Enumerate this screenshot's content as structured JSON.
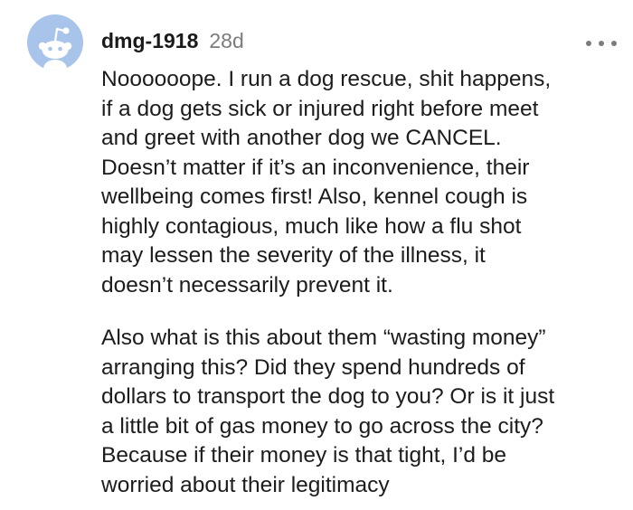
{
  "comment": {
    "username": "dmg-1918",
    "timestamp": "28d",
    "avatar_icon": "reddit-snoo-icon",
    "more_icon": "more-options-icon",
    "paragraphs": [
      {
        "lines": [
          "Noooooope. I run a dog rescue, shit happens,",
          "if a dog gets sick or injured right before meet",
          "and greet with another dog we CANCEL.",
          "Doesn’t matter if it’s an inconvenience, their",
          "wellbeing comes first! Also, kennel cough is",
          "highly contagious, much like how a flu shot",
          "may lessen the severity of the illness, it",
          "doesn’t necessarily prevent it."
        ]
      },
      {
        "lines": [
          "Also what is this about them “wasting money”",
          "arranging this? Did they spend hundreds of",
          "dollars to transport the dog to you? Or is it just",
          "a little bit of gas money to go across the city?",
          "Because if their money is that tight, I’d be",
          "worried about their legitimacy"
        ]
      }
    ]
  },
  "colors": {
    "avatar_bg": "#a9c4ea",
    "snoo": "#ffffff",
    "text": "#1c1c1c",
    "muted": "#7c7c7c"
  }
}
